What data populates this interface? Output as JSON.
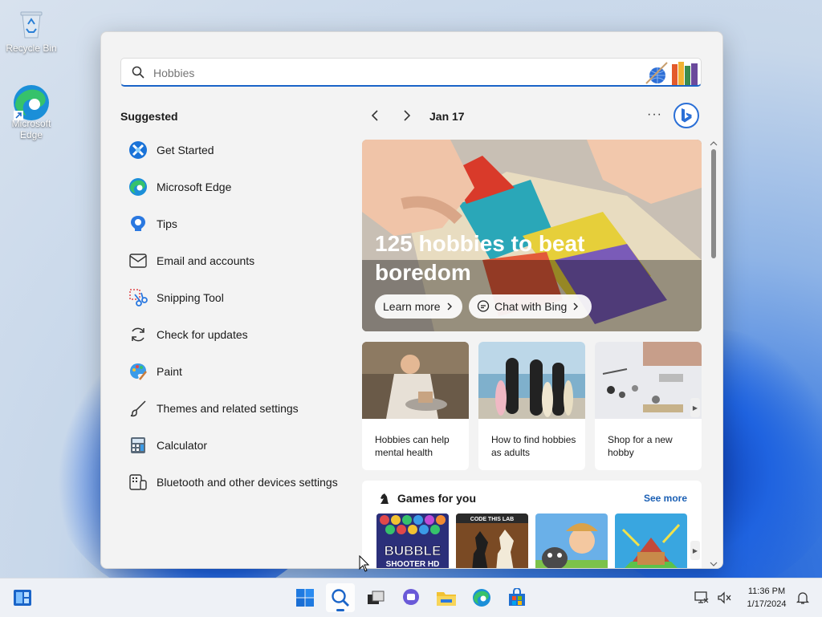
{
  "desktop": {
    "icons": [
      {
        "label": "Recycle Bin"
      },
      {
        "label": "Microsoft Edge"
      }
    ]
  },
  "search": {
    "value": "",
    "placeholder": "Hobbies"
  },
  "suggested": {
    "title": "Suggested",
    "items": [
      {
        "label": "Get Started",
        "icon": "get-started-icon"
      },
      {
        "label": "Microsoft Edge",
        "icon": "edge-icon"
      },
      {
        "label": "Tips",
        "icon": "tips-icon"
      },
      {
        "label": "Email and accounts",
        "icon": "mail-icon"
      },
      {
        "label": "Snipping Tool",
        "icon": "scissors-icon"
      },
      {
        "label": "Check for updates",
        "icon": "refresh-icon"
      },
      {
        "label": "Paint",
        "icon": "palette-icon"
      },
      {
        "label": "Themes and related settings",
        "icon": "brush-icon"
      },
      {
        "label": "Calculator",
        "icon": "calculator-icon"
      },
      {
        "label": "Bluetooth and other devices settings",
        "icon": "devices-icon"
      }
    ]
  },
  "highlights": {
    "date": "Jan 17",
    "more": "···",
    "hero": {
      "title": "125 hobbies to beat boredom",
      "learn_more": "Learn more",
      "chat": "Chat with Bing"
    },
    "cards": [
      {
        "text": "Hobbies can help mental health"
      },
      {
        "text": "How to find hobbies as adults"
      },
      {
        "text": "Shop for a new hobby"
      }
    ],
    "games": {
      "title": "Games for you",
      "see_more": "See more",
      "tile1_line1": "BUBBLE",
      "tile1_line2": "SHOOTER HD",
      "tile2_label": "CODE THIS LAB"
    }
  },
  "taskbar": {
    "time": "11:36 PM",
    "date": "1/17/2024"
  },
  "colors": {
    "accent": "#1a64c8",
    "panel_bg": "#f3f3f3",
    "link": "#1a5fb4"
  }
}
